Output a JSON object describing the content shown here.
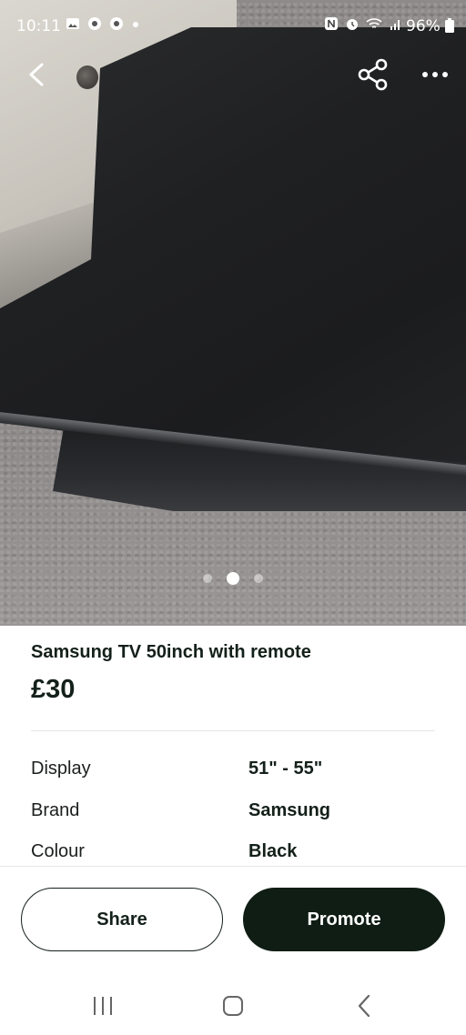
{
  "status_bar": {
    "time": "10:11",
    "battery": "96%",
    "left_icons": [
      "gallery-icon",
      "chrome-icon",
      "chrome-icon",
      "dot-icon"
    ],
    "right_icons": [
      "nfc-icon",
      "alarm-icon",
      "wifi-icon",
      "signal-icon",
      "battery-icon"
    ]
  },
  "photo": {
    "page_count": 3,
    "active_index": 1
  },
  "listing": {
    "title": "Samsung TV 50inch with remote",
    "price": "£30",
    "attributes": [
      {
        "label": "Display",
        "value": "51\" - 55\""
      },
      {
        "label": "Brand",
        "value": "Samsung"
      },
      {
        "label": "Colour",
        "value": "Black"
      }
    ]
  },
  "actions": {
    "share_label": "Share",
    "promote_label": "Promote"
  },
  "colors": {
    "primary_dark": "#0f1d14",
    "text": "#14201a"
  }
}
